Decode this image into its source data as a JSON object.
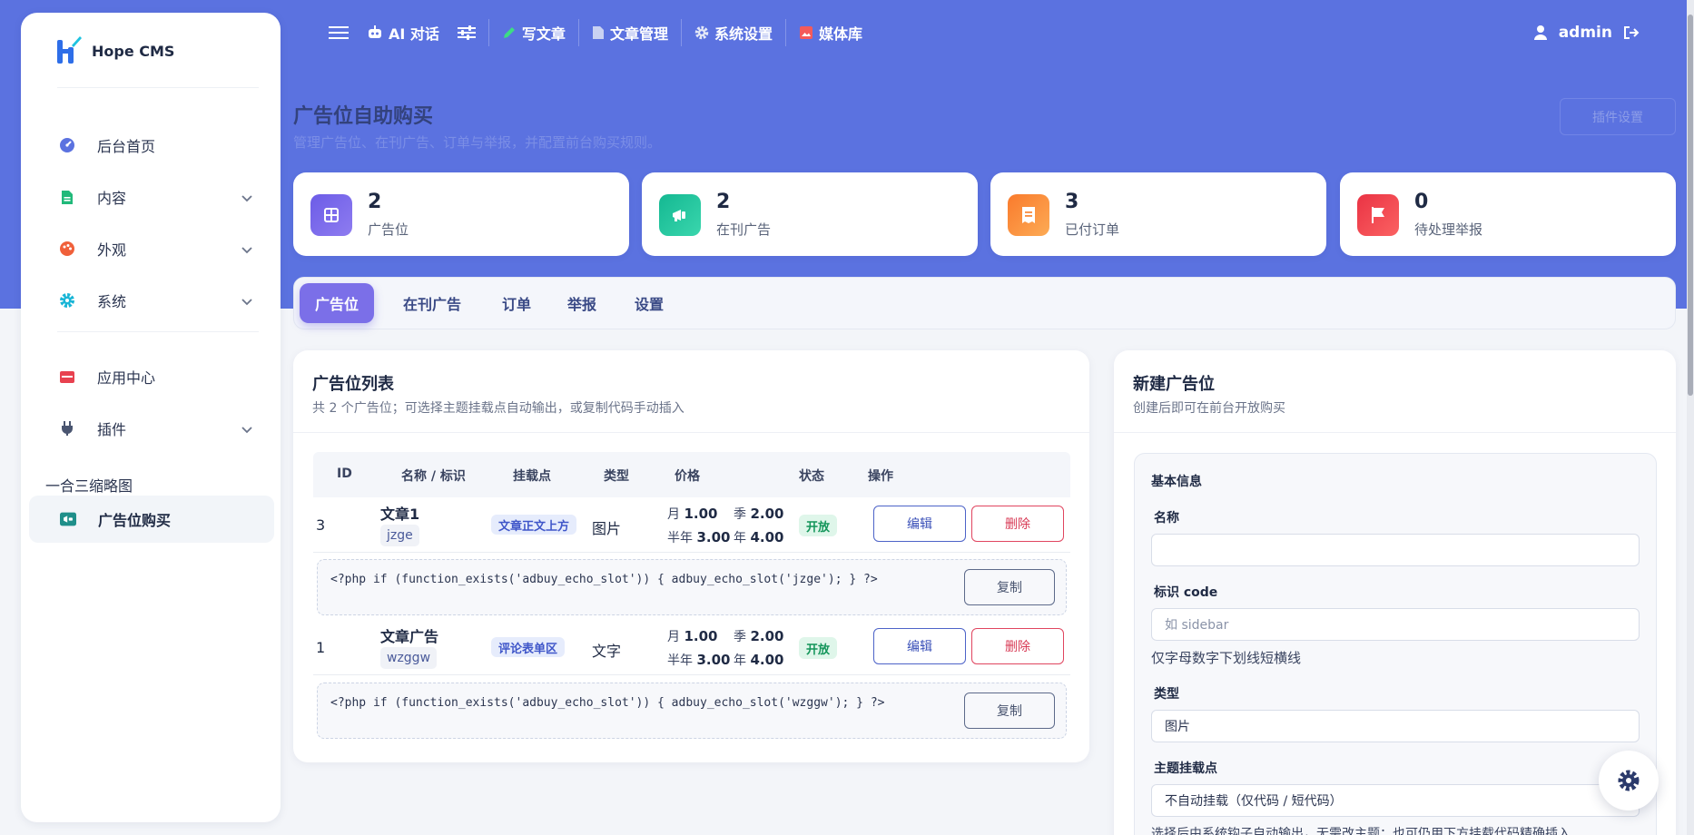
{
  "brand": {
    "name": "Hope CMS"
  },
  "sidebar": {
    "items": [
      {
        "label": "后台首页"
      },
      {
        "label": "内容"
      },
      {
        "label": "外观"
      },
      {
        "label": "系统"
      },
      {
        "label": "应用中心"
      },
      {
        "label": "插件"
      }
    ],
    "group_label": "一合三缩略图",
    "active_item": {
      "label": "广告位购买"
    }
  },
  "topnav": {
    "items": [
      {
        "label": "AI 对话"
      },
      {
        "label": "写文章"
      },
      {
        "label": "文章管理"
      },
      {
        "label": "系统设置"
      },
      {
        "label": "媒体库"
      }
    ],
    "user": "admin"
  },
  "page": {
    "title": "广告位自助购买",
    "subtitle": "管理广告位、在刊广告、订单与举报，并配置前台购买规则。",
    "plugin_settings_label": "插件设置"
  },
  "stats": [
    {
      "value": "2",
      "label": "广告位",
      "color": "#7360e4"
    },
    {
      "value": "2",
      "label": "在刊广告",
      "color": "#21c39b"
    },
    {
      "value": "3",
      "label": "已付订单",
      "color": "#fb8a3c"
    },
    {
      "value": "0",
      "label": "待处理举报",
      "color": "#ef4350"
    }
  ],
  "tabs": [
    {
      "label": "广告位"
    },
    {
      "label": "在刊广告"
    },
    {
      "label": "订单"
    },
    {
      "label": "举报"
    },
    {
      "label": "设置"
    }
  ],
  "list": {
    "title": "广告位列表",
    "subtitle": "共 2 个广告位；可选择主题挂载点自动输出，或复制代码手动插入",
    "columns": [
      "ID",
      "名称 / 标识",
      "挂载点",
      "类型",
      "价格",
      "状态",
      "操作"
    ],
    "rows": [
      {
        "id": "3",
        "name": "文章1",
        "code": "jzge",
        "hook": "文章正文上方",
        "type": "图片",
        "price_month_label": "月",
        "price_month": "1.00",
        "price_quarter_label": "季",
        "price_quarter": "2.00",
        "price_half_label": "半年",
        "price_half": "3.00",
        "price_year_label": "年",
        "price_year": "4.00",
        "status": "开放",
        "edit_label": "编辑",
        "delete_label": "删除",
        "snippet": "<?php if (function_exists('adbuy_echo_slot')) { adbuy_echo_slot('jzge'); } ?>",
        "copy_label": "复制"
      },
      {
        "id": "1",
        "name": "文章广告",
        "code": "wzggw",
        "hook": "评论表单区",
        "type": "文字",
        "price_month_label": "月",
        "price_month": "1.00",
        "price_quarter_label": "季",
        "price_quarter": "2.00",
        "price_half_label": "半年",
        "price_half": "3.00",
        "price_year_label": "年",
        "price_year": "4.00",
        "status": "开放",
        "edit_label": "编辑",
        "delete_label": "删除",
        "snippet": "<?php if (function_exists('adbuy_echo_slot')) { adbuy_echo_slot('wzggw'); } ?>",
        "copy_label": "复制"
      }
    ]
  },
  "form": {
    "title": "新建广告位",
    "subtitle": "创建后即可在前台开放购买",
    "section": "基本信息",
    "name_label": "名称",
    "name_value": "",
    "code_label": "标识 code",
    "code_placeholder": "如 sidebar",
    "code_hint": "仅字母数字下划线短横线",
    "type_label": "类型",
    "type_value": "图片",
    "hook_label": "主题挂载点",
    "hook_value": "不自动挂载（仅代码 / 短代码）",
    "hook_hint": "选择后由系统钩子自动输出，无需改主题；也可仍用下方挂载代码精确插入"
  }
}
